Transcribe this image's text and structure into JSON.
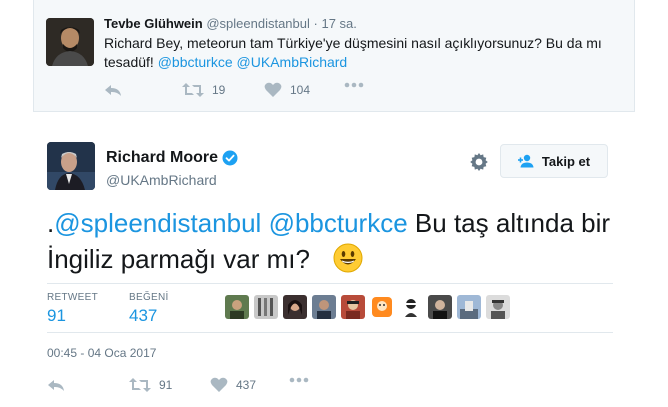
{
  "reply": {
    "name": "Tevbe Glühwein",
    "handle": "@spleendistanbul",
    "separator": "·",
    "time": "17 sa.",
    "text_main": "Richard Bey, meteorun tam Türkiye'ye düşmesini nasıl açıklıyorsunuz? Bu da mı tesadüf!",
    "mention1": "@bbcturkce",
    "mention2": "@UKAmbRichard",
    "actions": {
      "retweets": "19",
      "likes": "104"
    }
  },
  "tweet": {
    "name": "Richard Moore",
    "handle": "@UKAmbRichard",
    "follow_label": "Takip et",
    "text_prefix": ".",
    "mention1": "@spleendistanbul",
    "mention2": "@bbcturkce",
    "text_rest": "Bu taş altında bir İngiliz parmağı var mı?",
    "emoji_icon": "smiley-emoji",
    "stats": {
      "retweet_label": "RETWEET",
      "retweet_value": "91",
      "like_label": "BEĞENİ",
      "like_value": "437"
    },
    "timestamp": "00:45 - 04 Oca 2017",
    "actions": {
      "retweets": "91",
      "likes": "437"
    }
  },
  "colors": {
    "link": "#1b95e0",
    "muted": "#657786",
    "verified": "#1da1f2",
    "reply_bg": "#f5f8fa"
  }
}
